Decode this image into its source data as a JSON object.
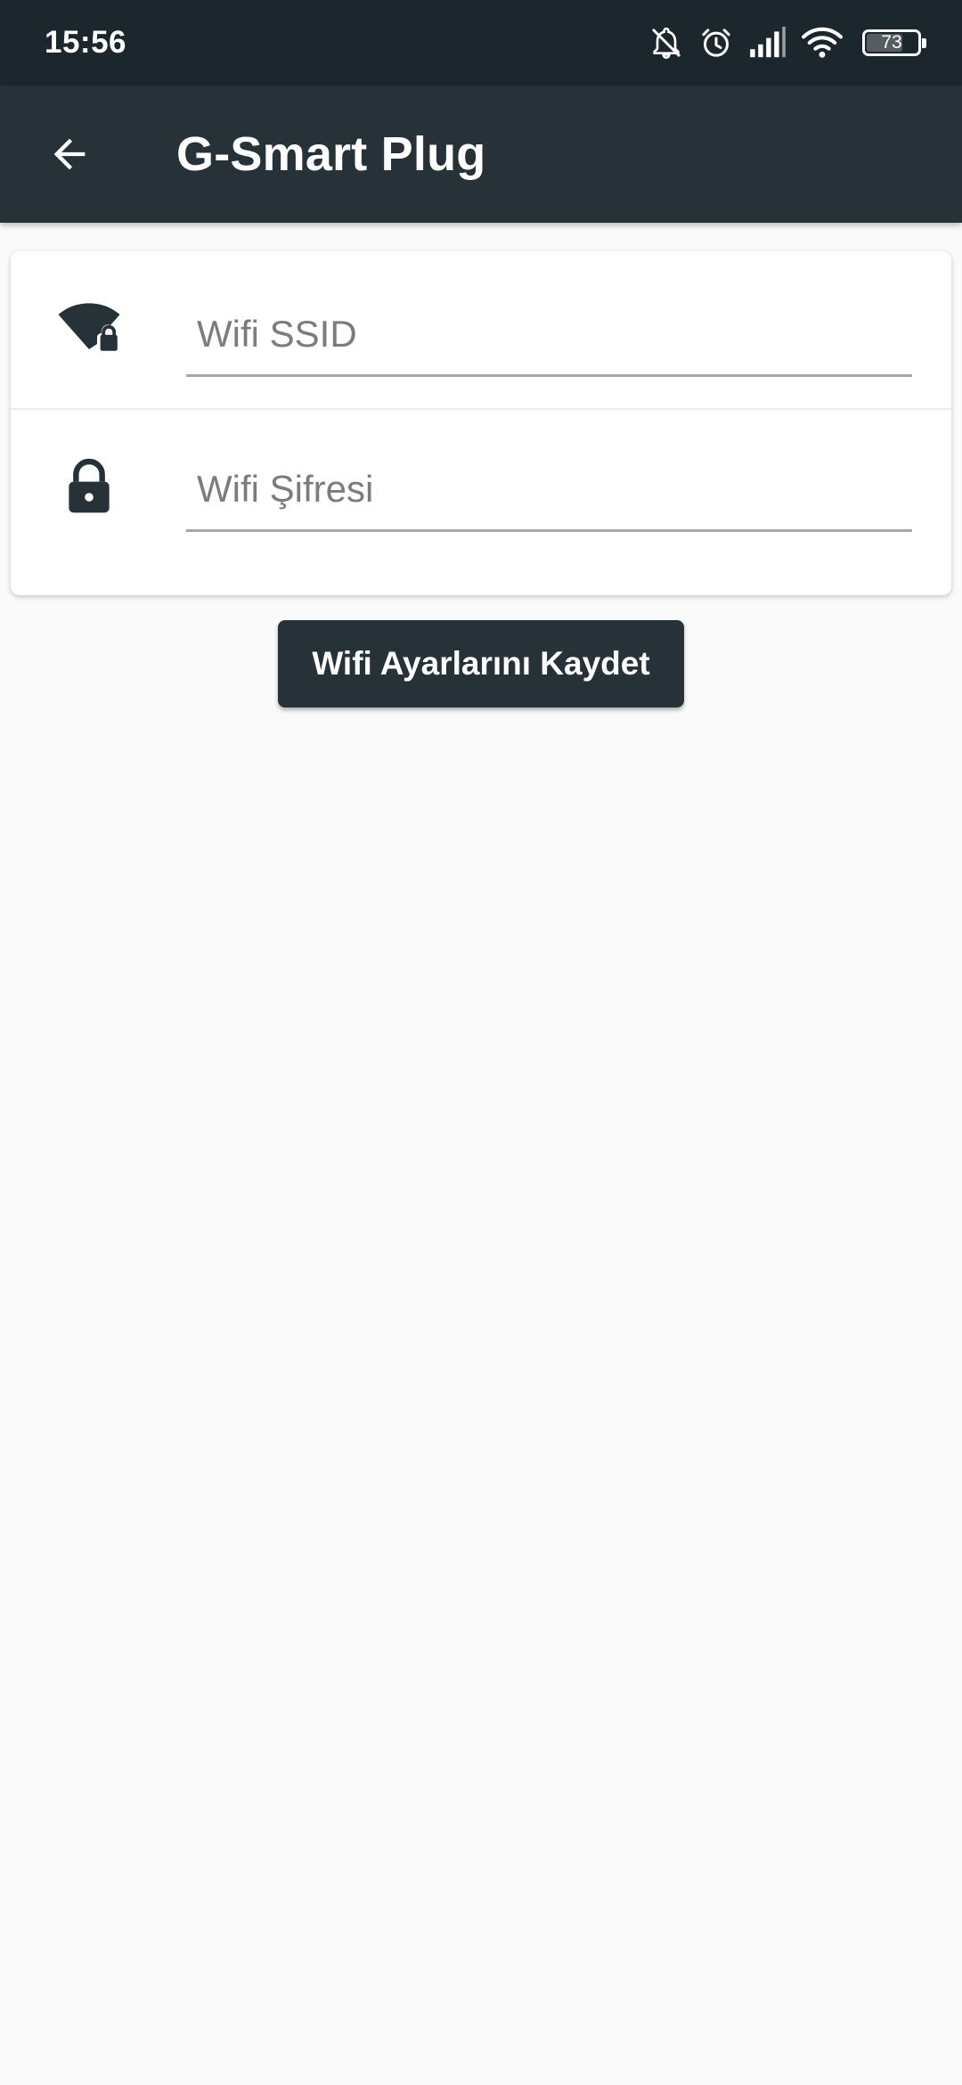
{
  "status_bar": {
    "time": "15:56",
    "battery_level": "73",
    "battery_fraction": 0.73,
    "icons": [
      "muted-bell-icon",
      "alarm-icon",
      "cell-signal-icon",
      "wifi-icon",
      "battery-icon"
    ]
  },
  "app_bar": {
    "back_icon": "arrow-left-icon",
    "title": "G-Smart Plug"
  },
  "form": {
    "ssid": {
      "icon": "wifi-lock-icon",
      "placeholder": "Wifi SSID",
      "value": ""
    },
    "password": {
      "icon": "lock-icon",
      "placeholder": "Wifi Şifresi",
      "value": ""
    }
  },
  "actions": {
    "save_label": "Wifi Ayarlarını Kaydet"
  },
  "colors": {
    "status_bar_bg": "#1c272d",
    "app_bar_bg": "#263238",
    "button_bg": "#263238",
    "page_bg": "#fafafa",
    "icon_color": "#263238"
  }
}
